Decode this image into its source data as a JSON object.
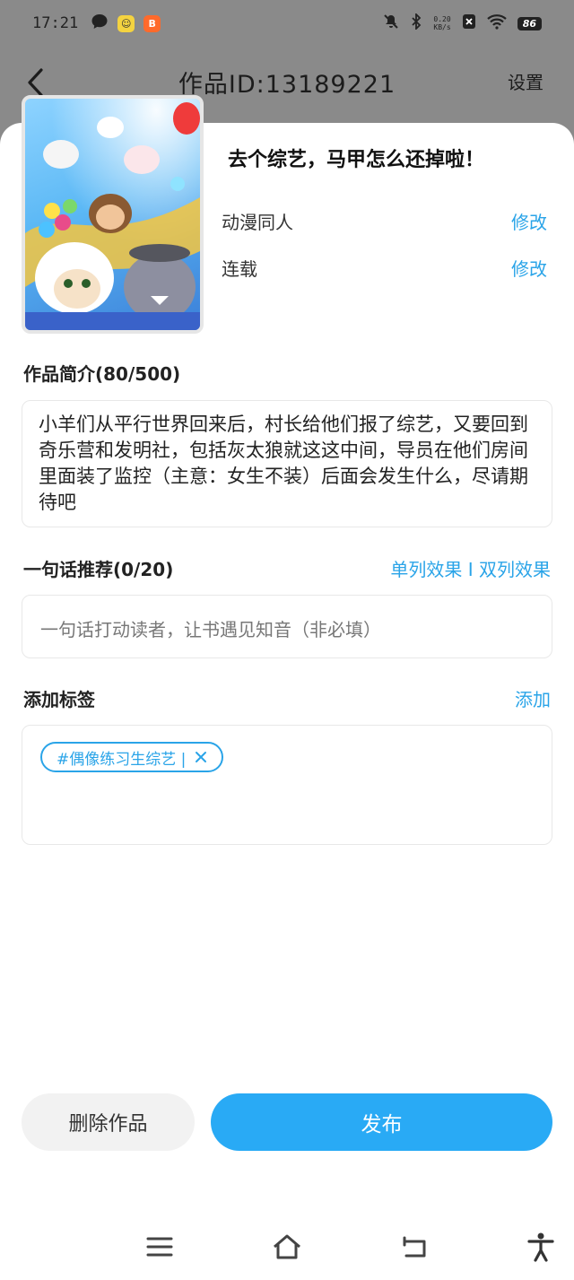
{
  "status_bar": {
    "time": "17:21",
    "net_speed_value": "0.20",
    "net_speed_unit": "KB/s",
    "battery": "86"
  },
  "nav": {
    "title": "作品ID:13189221",
    "settings": "设置"
  },
  "work": {
    "title": "去个综艺，马甲怎么还掉啦！",
    "category": "动漫同人",
    "status": "连载",
    "edit_label_1": "修改",
    "edit_label_2": "修改"
  },
  "synopsis": {
    "header": "作品简介(80/500)",
    "text": "小羊们从平行世界回来后，村长给他们报了综艺，又要回到奇乐营和发明社，包括灰太狼就这这中间，导员在他们房间里面装了监控（主意：女生不装）后面会发生什么，尽请期待吧"
  },
  "recommend": {
    "header": "一句话推荐(0/20)",
    "toggle": "单列效果 I 双列效果",
    "placeholder": "一句话打动读者，让书遇见知音（非必填）"
  },
  "tags": {
    "header": "添加标签",
    "add": "添加",
    "items": [
      "#偶像练习生综艺 |"
    ]
  },
  "actions": {
    "delete": "删除作品",
    "publish": "发布"
  },
  "colors": {
    "accent": "#2aa4e8",
    "publish_bg": "#29aaf5",
    "overlay_bg": "#8a8a8a"
  }
}
